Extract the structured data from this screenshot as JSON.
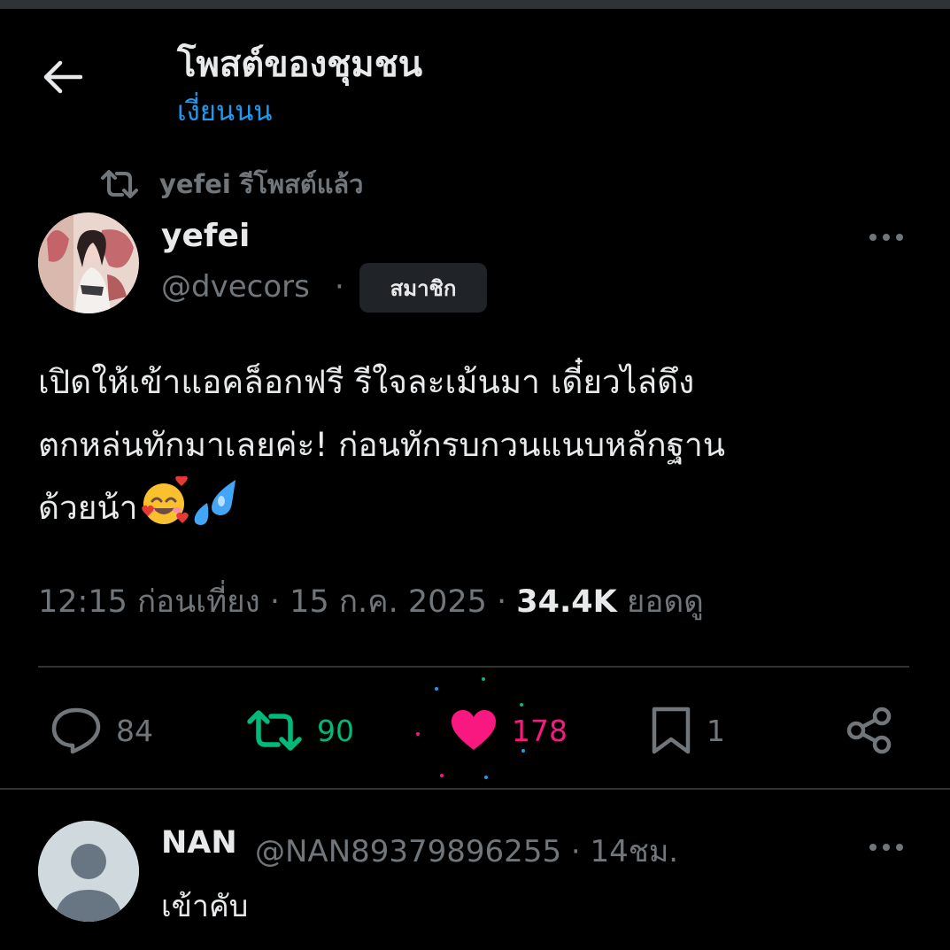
{
  "header": {
    "title": "โพสต์ของชุมชน",
    "subtitle": "เงี่ยนนน",
    "back_icon": "arrow-left-icon"
  },
  "repost_context": {
    "text": "yefei รีโพสต์แล้ว",
    "icon": "repost-icon"
  },
  "post": {
    "author_name": "yefei",
    "author_handle": "@dvecors",
    "separator": "·",
    "badge": "สมาชิก",
    "more_icon": "more-icon",
    "text_lines": [
      "เปิดให้เข้าแอคล็อกฟรี รีใจละเม้นมา  เดี๋ยวไล่ดึง",
      "ตกหล่นทักมาเลยค่ะ! ก่อนทักรบกวนแนบหลักฐาน",
      "ด้วยน้า"
    ],
    "emojis": [
      "smiling-face-with-hearts-icon",
      "sweat-droplets-icon"
    ],
    "time": "12:15 ก่อนเที่ยง",
    "date": "15 ก.ค. 2025",
    "views_count": "34.4K",
    "views_label": "ยอดดู",
    "actions": {
      "replies": "84",
      "reposts": "90",
      "likes": "178",
      "bookmarks": "1"
    }
  },
  "reply": {
    "name": "NAN",
    "handle_time": "@NAN89379896255 · 14ชม.",
    "text": "เข้าคับ"
  },
  "colors": {
    "background": "#000000",
    "text": "#e7e9ea",
    "muted": "#71767b",
    "accent": "#1d9bf0",
    "repost": "#00ba7c",
    "like": "#f91880",
    "divider": "#2f3336"
  }
}
